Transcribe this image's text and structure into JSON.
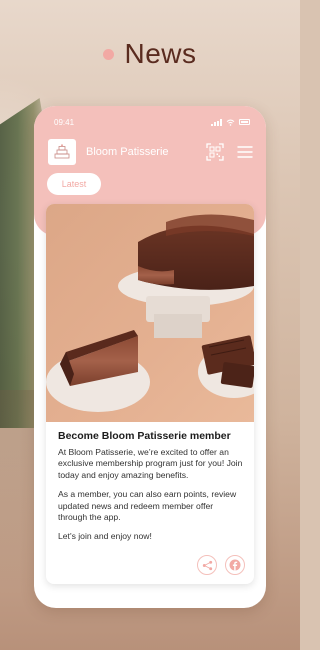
{
  "heading": {
    "title": "News"
  },
  "status_bar": {
    "time": "09:41"
  },
  "app": {
    "name": "Bloom Patisserie"
  },
  "tabs": [
    {
      "label": "Latest",
      "selected": true
    }
  ],
  "post": {
    "title": "Become Bloom Patisserie member",
    "paragraphs": [
      "At Bloom Patisserie, we’re excited to offer an exclusive membership program just for you! Join today and enjoy amazing benefits.",
      "As a member, you can also earn points, review updated news and redeem member offer through the app.",
      "Let's join and enjoy now!"
    ],
    "image_subject": "chocolate crepe cake with a cut slice and chocolate bar pieces"
  },
  "icons": {
    "logo": "bloom-patisserie-logo",
    "qr": "qr-scan-icon",
    "menu": "hamburger-menu-icon",
    "share": "share-icon",
    "facebook": "facebook-icon"
  },
  "colors": {
    "accent_pink": "#f4c0bb",
    "heading_brown": "#5a2b1f",
    "background": "#d9c3b1"
  }
}
